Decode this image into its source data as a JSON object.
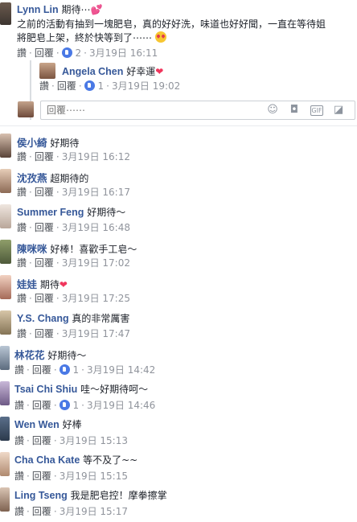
{
  "comments": [
    {
      "name": "Lynn Lin",
      "text": "期待⋯",
      "lines": [
        "之前的活動有抽到一塊肥皂，真的好好洗，味道也好好聞，一直在等待姐",
        "將肥皂上架，終於快等到了⋯⋯"
      ],
      "like_label": "讚",
      "reply_label": "回覆",
      "likes": "2",
      "date": "3月19日 16:11"
    },
    {
      "name": "Angela Chen",
      "text": "好幸運",
      "like_label": "讚",
      "reply_label": "回覆",
      "likes": "1",
      "date": "3月19日 19:02"
    },
    {
      "name": "侯小綺",
      "text": "好期待",
      "like_label": "讚",
      "reply_label": "回覆",
      "date": "3月19日 16:12"
    },
    {
      "name": "沈孜燕",
      "text": "超期待的",
      "like_label": "讚",
      "reply_label": "回覆",
      "date": "3月19日 16:17"
    },
    {
      "name": "Summer Feng",
      "text": "好期待～",
      "like_label": "讚",
      "reply_label": "回覆",
      "date": "3月19日 16:48"
    },
    {
      "name": "陳咪咪",
      "text": "好棒！喜歡手工皂～",
      "like_label": "讚",
      "reply_label": "回覆",
      "date": "3月19日 17:02"
    },
    {
      "name": "娃娃",
      "text": "期待",
      "like_label": "讚",
      "reply_label": "回覆",
      "date": "3月19日 17:25"
    },
    {
      "name": "Y.S. Chang",
      "text": "真的非常厲害",
      "like_label": "讚",
      "reply_label": "回覆",
      "date": "3月19日 17:47"
    },
    {
      "name": "林花花",
      "text": "好期待～",
      "like_label": "讚",
      "reply_label": "回覆",
      "likes": "1",
      "date": "3月19日 14:42"
    },
    {
      "name": "Tsai Chi Shiu",
      "text": "哇～好期待呵～",
      "like_label": "讚",
      "reply_label": "回覆",
      "likes": "1",
      "date": "3月19日 14:46"
    },
    {
      "name": "Wen Wen",
      "text": "好棒",
      "like_label": "讚",
      "reply_label": "回覆",
      "date": "3月19日 15:13"
    },
    {
      "name": "Cha Cha Kate",
      "text": "等不及了~~",
      "like_label": "讚",
      "reply_label": "回覆",
      "date": "3月19日 15:15"
    },
    {
      "name": "Ling Tseng",
      "text": "我是肥皂控！摩拳擦掌",
      "like_label": "讚",
      "reply_label": "回覆",
      "date": "3月19日 15:17"
    }
  ],
  "reply_box": {
    "placeholder": "回覆⋯⋯"
  },
  "icons": {
    "like": "thumbs-up-icon",
    "emoji": "smiley-icon",
    "camera": "camera-icon",
    "gif": "gif-icon",
    "sticker": "sticker-icon"
  },
  "colors": {
    "name": "#365899",
    "meta": "#90949c",
    "link": "#4b4f56",
    "like_badge": "#4a79e5",
    "heart": "#f0355c"
  }
}
